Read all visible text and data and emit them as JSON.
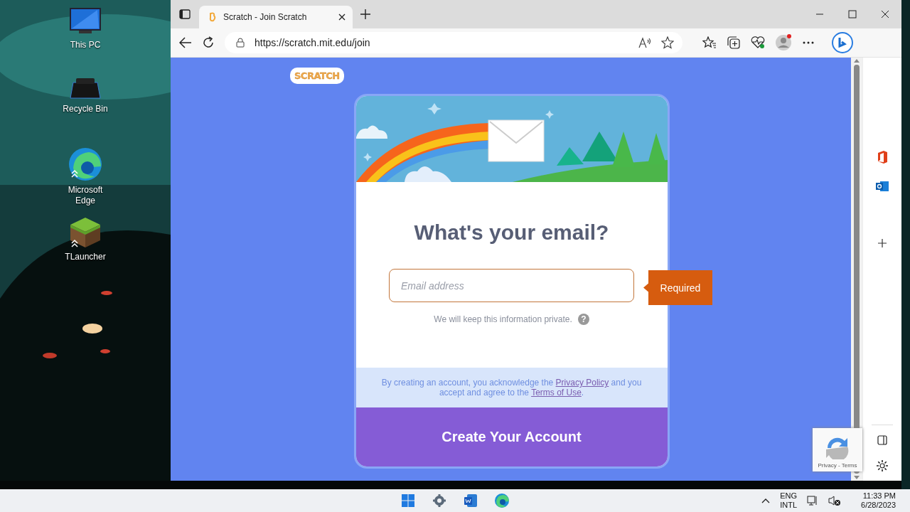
{
  "desktop_icons": [
    {
      "label": "This PC",
      "kind": "computer"
    },
    {
      "label": "Recycle Bin",
      "kind": "bin"
    },
    {
      "label": "Microsoft Edge",
      "kind": "edge"
    },
    {
      "label": "TLauncher",
      "kind": "block"
    }
  ],
  "browser": {
    "tabs": [
      {
        "title": "Scratch - Join Scratch",
        "selected": true
      }
    ],
    "url": "https://scratch.mit.edu/join"
  },
  "page": {
    "logo": "SCRATCH",
    "heading": "What's your email?",
    "email_field": {
      "placeholder": "Email address"
    },
    "validation": "Required",
    "privacy_note": "We will keep this information private.",
    "help": "?",
    "terms": [
      {
        "kind": "text",
        "text": "By creating an account, you acknowledge the "
      },
      {
        "kind": "link",
        "text": "Privacy Policy"
      },
      {
        "kind": "text",
        "text": " and you accept and agree to the "
      },
      {
        "kind": "link",
        "text": "Terms of Use"
      },
      {
        "kind": "text",
        "text": "."
      }
    ],
    "submit": "Create Your Account"
  },
  "recaptcha": {
    "text": "Privacy - Terms"
  },
  "taskbar": {
    "language": "ENG",
    "layout": "INTL",
    "time": "11:33 PM",
    "date": "6/28/2023"
  }
}
